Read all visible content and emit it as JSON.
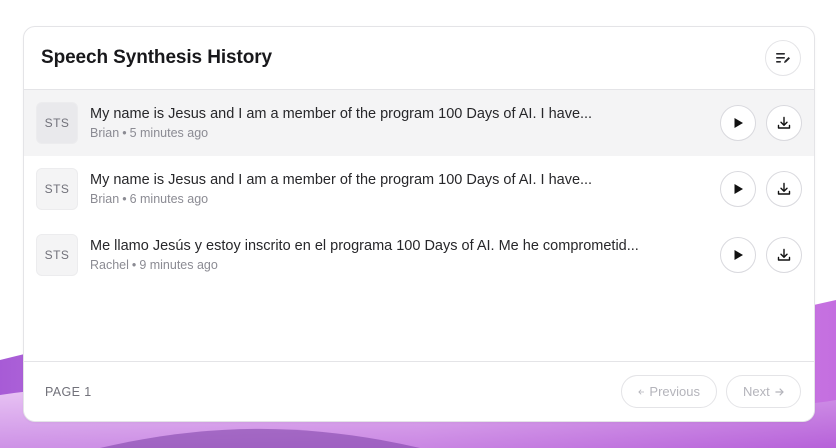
{
  "panel": {
    "title": "Speech Synthesis History"
  },
  "history": [
    {
      "badge": "STS",
      "title": "My name is Jesus and I am a member of the program 100 Days of AI. I have...",
      "voice": "Brian",
      "time": "5 minutes ago"
    },
    {
      "badge": "STS",
      "title": "My name is Jesus and I am a member of the program 100 Days of AI. I have...",
      "voice": "Brian",
      "time": "6 minutes ago"
    },
    {
      "badge": "STS",
      "title": "Me llamo Jesús y estoy inscrito en el programa 100 Days of AI. Me he comprometid...",
      "voice": "Rachel",
      "time": "9 minutes ago"
    }
  ],
  "meta_separator": "•",
  "footer": {
    "page_label": "PAGE 1",
    "previous_label": "Previous",
    "next_label": "Next"
  },
  "icons": {
    "header_action": "list-edit-icon",
    "play": "play-icon",
    "download": "download-icon",
    "previous": "arrow-left-icon",
    "next": "arrow-right-icon"
  },
  "colors": {
    "active_row": "#f4f4f5",
    "background_wave": "#c77dde"
  }
}
